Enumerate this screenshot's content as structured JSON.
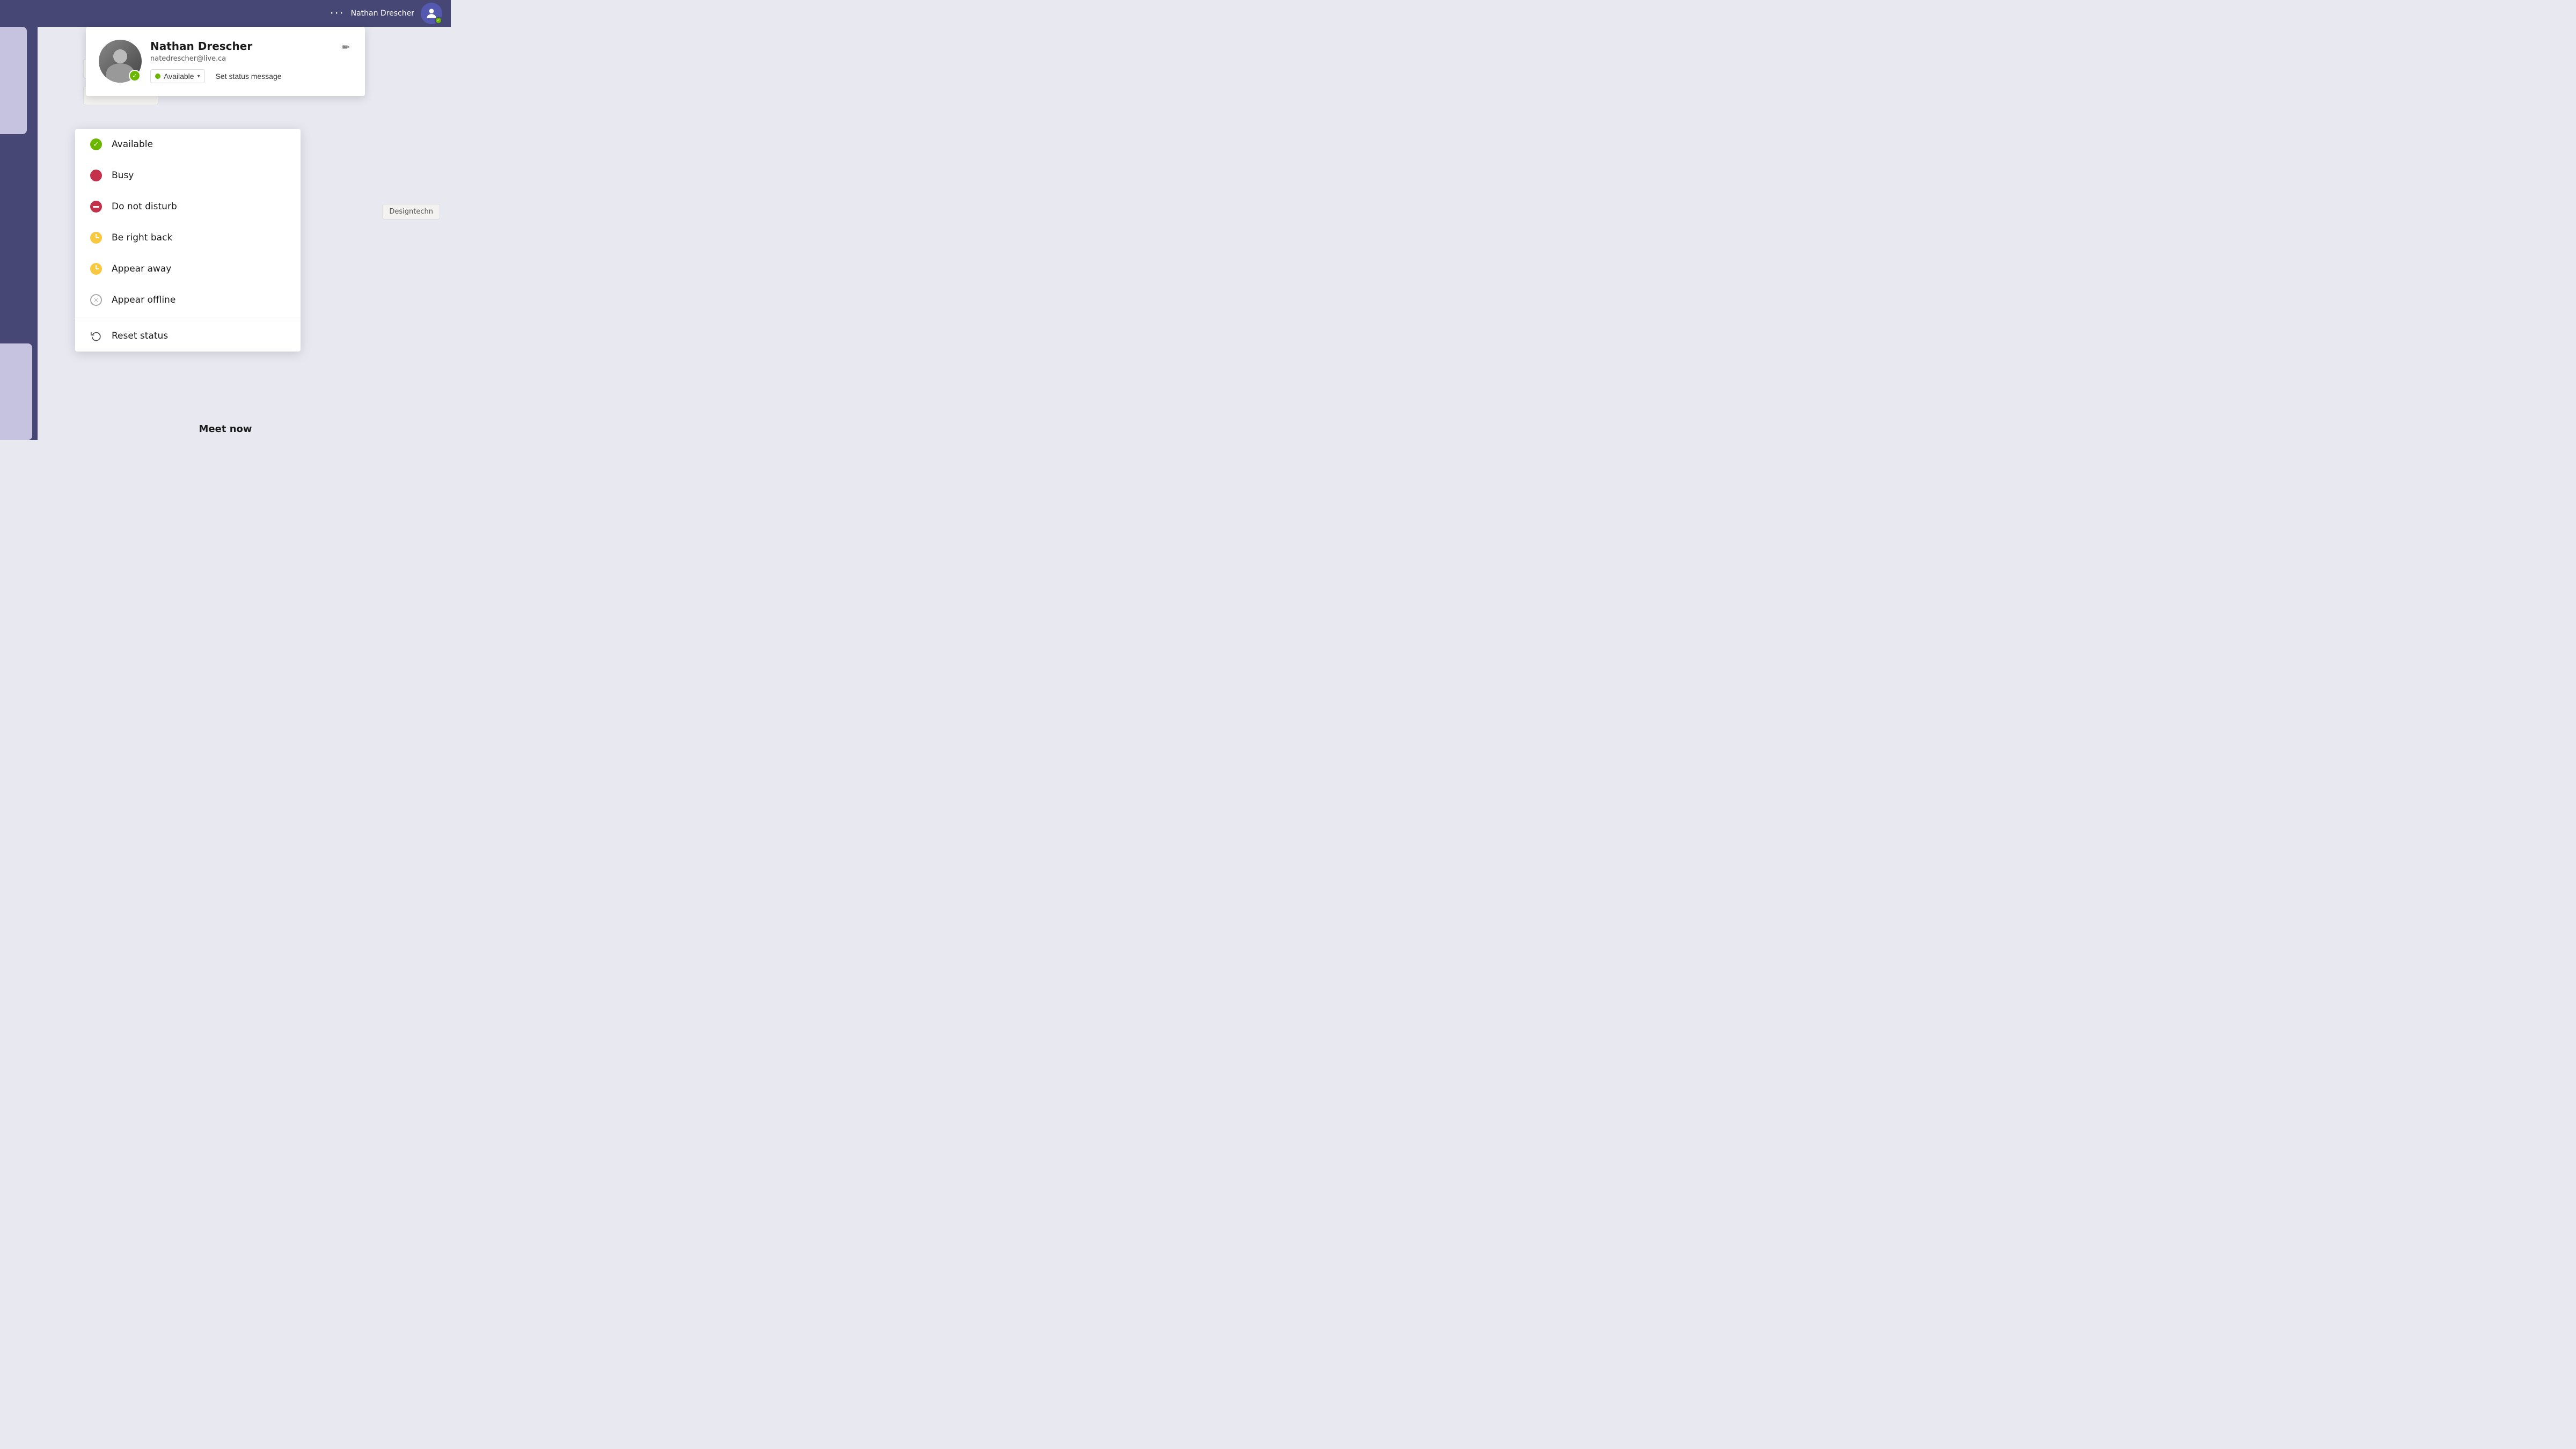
{
  "header": {
    "dots": "···",
    "username": "Nathan Drescher",
    "avatar_icon": "person-icon"
  },
  "profile": {
    "name": "Nathan Drescher",
    "email": "natedrescher@live.ca",
    "status_label": "Available",
    "set_status_label": "Set status message",
    "edit_icon": "pencil-icon"
  },
  "status_menu": {
    "items": [
      {
        "id": "available",
        "label": "Available",
        "icon_type": "green-check",
        "color": "#6bb700"
      },
      {
        "id": "busy",
        "label": "Busy",
        "icon_type": "red-circle",
        "color": "#c4314b"
      },
      {
        "id": "do-not-disturb",
        "label": "Do not disturb",
        "icon_type": "red-minus",
        "color": "#c4314b"
      },
      {
        "id": "be-right-back",
        "label": "Be right back",
        "icon_type": "yellow-clock",
        "color": "#f8c940"
      },
      {
        "id": "appear-away",
        "label": "Appear away",
        "icon_type": "yellow-clock",
        "color": "#f8c940"
      },
      {
        "id": "appear-offline",
        "label": "Appear offline",
        "icon_type": "gray-x",
        "color": "#aaa"
      }
    ],
    "reset_label": "Reset status",
    "reset_icon": "reset-icon"
  },
  "bg": {
    "tooltip": "Designtechn",
    "meet_now": "Meet now"
  }
}
